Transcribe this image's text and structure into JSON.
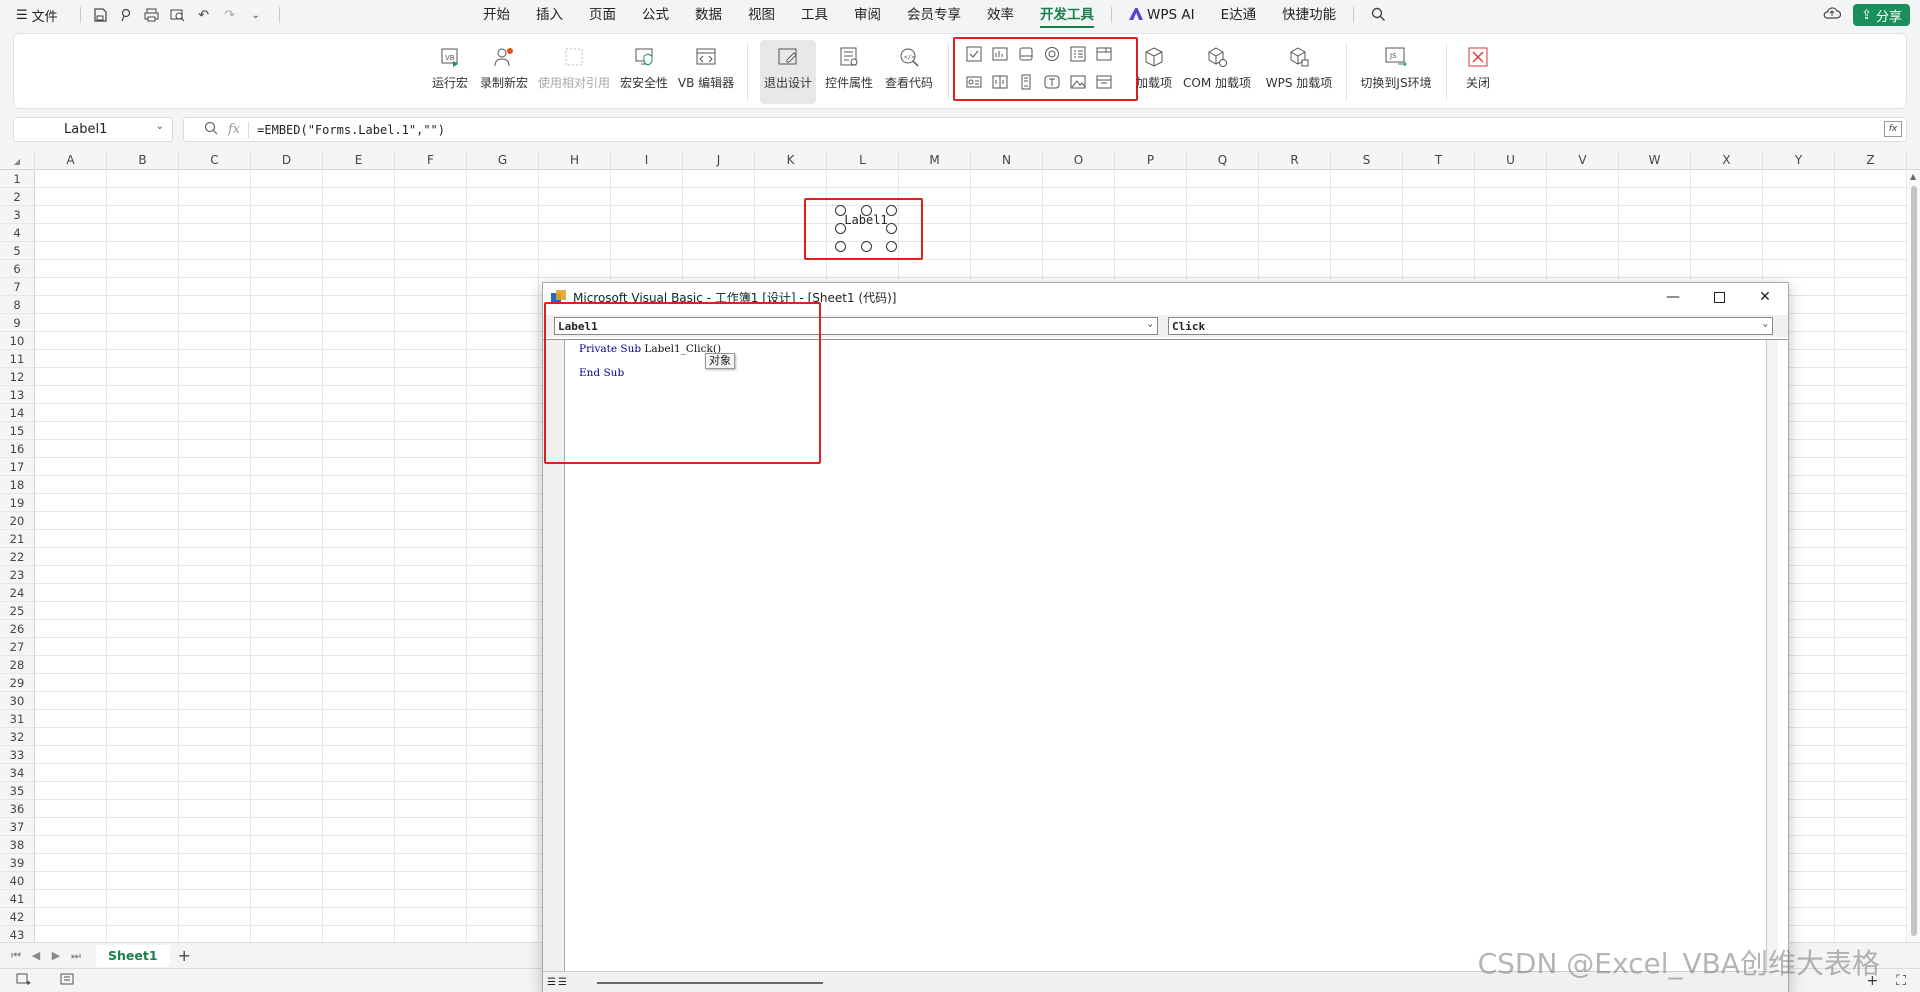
{
  "menubar": {
    "file_label": "文件",
    "tabs": [
      "开始",
      "插入",
      "页面",
      "公式",
      "数据",
      "视图",
      "工具",
      "审阅",
      "会员专享",
      "效率",
      "开发工具"
    ],
    "tabs_right": [
      "WPS AI",
      "E达通",
      "快捷功能"
    ],
    "active_tab": "开发工具",
    "share_label": "分享"
  },
  "ribbon": {
    "run_macro": "运行宏",
    "record_macro": "录制新宏",
    "relative_ref": "使用相对引用",
    "macro_security": "宏安全性",
    "vb_editor": "VB 编辑器",
    "exit_design": "退出设计",
    "control_props": "控件属性",
    "view_code": "查看代码",
    "addins": "加载项",
    "com_addins": "COM 加载项",
    "wps_addins": "WPS 加载项",
    "switch_js": "切换到JS环境",
    "close": "关闭"
  },
  "formula": {
    "name_box": "Label1",
    "fx": "fx",
    "content": "=EMBED(\"Forms.Label.1\",\"\")"
  },
  "grid": {
    "columns": [
      "A",
      "B",
      "C",
      "D",
      "E",
      "F",
      "G",
      "H",
      "I",
      "J",
      "K",
      "L",
      "M",
      "N",
      "O",
      "P",
      "Q",
      "R",
      "S",
      "T",
      "U",
      "V",
      "W",
      "X",
      "Y",
      "Z"
    ],
    "row_count": 43,
    "label_control_text": "Label1"
  },
  "sheets": {
    "active": "Sheet1",
    "add": "+"
  },
  "vba": {
    "title": "Microsoft Visual Basic - 工作簿1 [设计] - [Sheet1 (代码)]",
    "object_combo": "Label1",
    "proc_combo": "Click",
    "code_line1_kw": "Private Sub",
    "code_line1_rest": " Label1_Click()",
    "code_line2": "End Sub",
    "tooltip": "对象"
  },
  "watermark": "CSDN @Excel_VBA创维大表格",
  "colors": {
    "accent": "#1a7f4b",
    "highlight": "#e02020",
    "keyword": "#00008b"
  }
}
